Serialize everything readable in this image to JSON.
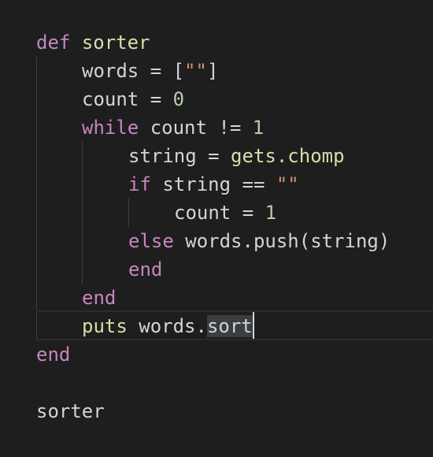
{
  "editor": {
    "lines": [
      {
        "id": "line-1",
        "tokens": [
          {
            "text": "def",
            "role": "keyword"
          },
          {
            "text": " "
          },
          {
            "text": "sorter",
            "role": "function"
          }
        ]
      },
      {
        "id": "line-2",
        "tokens": [
          {
            "text": "words = ["
          },
          {
            "text": "\"\"",
            "role": "string"
          },
          {
            "text": "]"
          }
        ]
      },
      {
        "id": "line-3",
        "tokens": [
          {
            "text": "count = "
          },
          {
            "text": "0",
            "role": "number"
          }
        ]
      },
      {
        "id": "line-4",
        "tokens": [
          {
            "text": "while",
            "role": "keyword"
          },
          {
            "text": " count != "
          },
          {
            "text": "1",
            "role": "number"
          }
        ]
      },
      {
        "id": "line-5",
        "tokens": [
          {
            "text": "string = "
          },
          {
            "text": "gets.chomp",
            "role": "function"
          }
        ]
      },
      {
        "id": "line-6",
        "tokens": [
          {
            "text": "if",
            "role": "keyword"
          },
          {
            "text": " string == "
          },
          {
            "text": "\"\"",
            "role": "string"
          }
        ]
      },
      {
        "id": "line-7",
        "tokens": [
          {
            "text": "count = "
          },
          {
            "text": "1",
            "role": "number"
          }
        ]
      },
      {
        "id": "line-8",
        "tokens": [
          {
            "text": "else",
            "role": "keyword"
          },
          {
            "text": " words.push(string)"
          }
        ]
      },
      {
        "id": "line-9",
        "tokens": [
          {
            "text": "end",
            "role": "keyword"
          }
        ]
      },
      {
        "id": "line-10",
        "tokens": [
          {
            "text": "end",
            "role": "keyword"
          }
        ]
      },
      {
        "id": "line-11",
        "tokens": [
          {
            "text": "puts",
            "role": "function"
          },
          {
            "text": " words."
          },
          {
            "text": "sort",
            "role": "selection"
          }
        ]
      },
      {
        "id": "line-12",
        "tokens": [
          {
            "text": "end",
            "role": "keyword"
          }
        ]
      },
      {
        "id": "line-13",
        "tokens": []
      },
      {
        "id": "line-14",
        "tokens": [
          {
            "text": "sorter"
          }
        ]
      }
    ]
  },
  "colors": {
    "background": "#1e1e1e",
    "keyword": "#c586c0",
    "function": "#dcdcaa",
    "string": "#ce9178",
    "number": "#b5cea8",
    "plain": "#d4d4d4",
    "selection": "#3a3d41",
    "indent_guide": "#404040"
  }
}
